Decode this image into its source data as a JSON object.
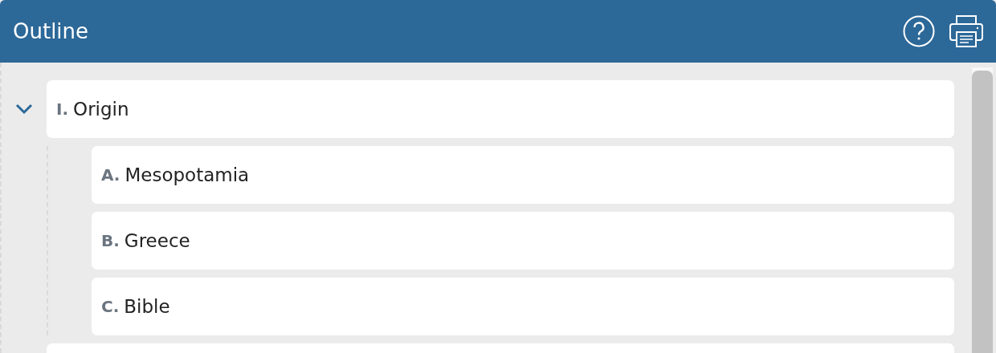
{
  "header": {
    "title": "Outline"
  },
  "outline": [
    {
      "marker": "I.",
      "label": "Origin",
      "expanded": true,
      "children": [
        {
          "marker": "A.",
          "label": "Mesopotamia"
        },
        {
          "marker": "B.",
          "label": "Greece"
        },
        {
          "marker": "C.",
          "label": "Bible"
        }
      ]
    }
  ],
  "more_items_below": true
}
